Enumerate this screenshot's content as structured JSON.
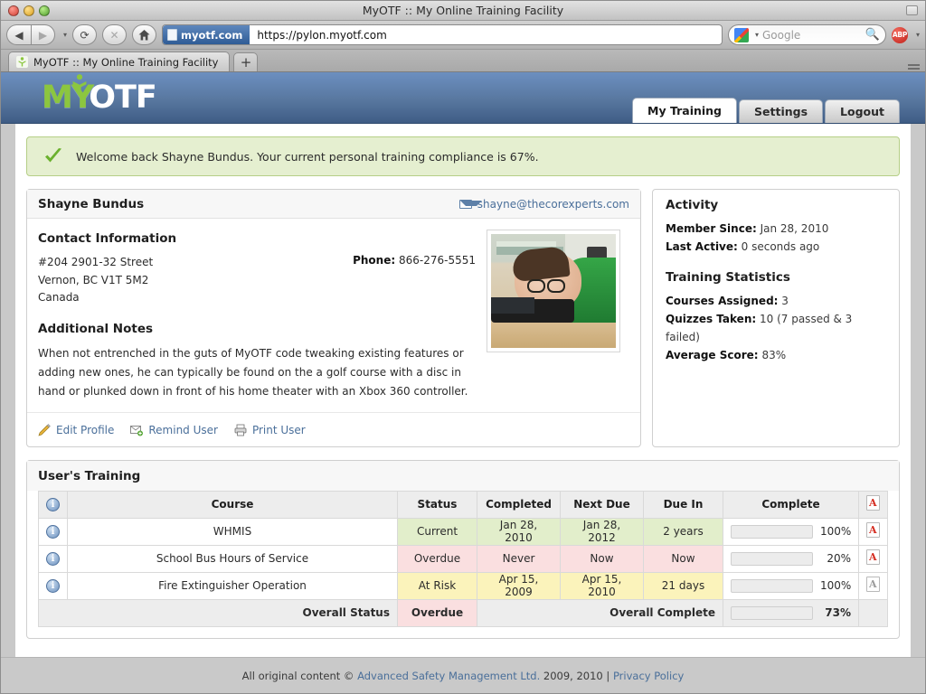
{
  "browser": {
    "window_title": "MyOTF :: My Online Training Facility",
    "back_label": "◀",
    "forward_label": "▶",
    "dropdown_caret": "▾",
    "reload_label": "⟳",
    "stop_label": "✕",
    "home_label": "⌂",
    "site_chip": "myotf.com",
    "url": "https://pylon.myotf.com",
    "search_placeholder": "Google",
    "search_value": "",
    "search_icon": "🔍",
    "adblock_label": "ABP",
    "tab_title": "MyOTF :: My Online Training Facility",
    "newtab_label": "+"
  },
  "header": {
    "logo_my": "MY",
    "logo_otf": "OTF",
    "tabs": [
      {
        "label": "My Training",
        "active": true
      },
      {
        "label": "Settings",
        "active": false
      },
      {
        "label": "Logout",
        "active": false
      }
    ]
  },
  "banner": {
    "text": "Welcome back Shayne Bundus. Your current personal training compliance is 67%.",
    "compliance": "67%"
  },
  "profile": {
    "name": "Shayne Bundus",
    "email": "shayne@thecorexperts.com",
    "contact_heading": "Contact Information",
    "address_line1": "#204 2901-32 Street",
    "address_line2": "Vernon, BC V1T 5M2",
    "address_line3": "Canada",
    "phone_label": "Phone:",
    "phone": "866-276-5551",
    "notes_heading": "Additional Notes",
    "notes": "When not entrenched in the guts of MyOTF code tweaking existing features or adding new ones, he can typically be found on the a golf course with a disc in hand or plunked down in front of his home theater with an Xbox 360 controller.",
    "actions": [
      {
        "label": "Edit Profile",
        "icon": "pencil-icon"
      },
      {
        "label": "Remind User",
        "icon": "envelope-add-icon"
      },
      {
        "label": "Print User",
        "icon": "printer-icon"
      }
    ]
  },
  "activity": {
    "title": "Activity",
    "member_since_label": "Member Since:",
    "member_since": "Jan 28, 2010",
    "last_active_label": "Last Active:",
    "last_active": "0 seconds ago",
    "stats_title": "Training Statistics",
    "courses_assigned_label": "Courses Assigned:",
    "courses_assigned": "3",
    "quizzes_taken_label": "Quizzes Taken:",
    "quizzes_taken": "10 (7 passed & 3 failed)",
    "average_score_label": "Average Score:",
    "average_score": "83%"
  },
  "training": {
    "title": "User's Training",
    "columns": [
      "",
      "Course",
      "Status",
      "Completed",
      "Next Due",
      "Due In",
      "Complete",
      ""
    ],
    "rows": [
      {
        "course": "WHMIS",
        "status": "Current",
        "status_color": "green",
        "completed": "Jan 28, 2010",
        "next_due": "Jan 28, 2012",
        "due_in": "2 years",
        "percent": 100,
        "percent_label": "100%",
        "pdf_enabled": true
      },
      {
        "course": "School Bus Hours of Service",
        "status": "Overdue",
        "status_color": "pink",
        "completed": "Never",
        "next_due": "Now",
        "due_in": "Now",
        "percent": 20,
        "percent_label": "20%",
        "pdf_enabled": true
      },
      {
        "course": "Fire Extinguisher Operation",
        "status": "At Risk",
        "status_color": "yellow",
        "completed": "Apr 15, 2009",
        "next_due": "Apr 15, 2010",
        "due_in": "21 days",
        "percent": 100,
        "percent_label": "100%",
        "pdf_enabled": false
      }
    ],
    "footer": {
      "overall_status_label": "Overall Status",
      "overall_status": "Overdue",
      "overall_complete_label": "Overall Complete",
      "overall_percent": 73,
      "overall_percent_label": "73%"
    }
  },
  "footer": {
    "prefix": "All original content ©",
    "company": "Advanced Safety Management Ltd.",
    "years": "2009, 2010",
    "separator": "|",
    "privacy": "Privacy Policy"
  },
  "colors": {
    "accent_green": "#8cc63f",
    "link_blue": "#4a6f9a",
    "status_green_bg": "#e2eecb",
    "status_pink_bg": "#fadfe0",
    "status_yellow_bg": "#fbf3bb",
    "banner_bg": "#e5efd0",
    "header_blue": "#58779f"
  }
}
